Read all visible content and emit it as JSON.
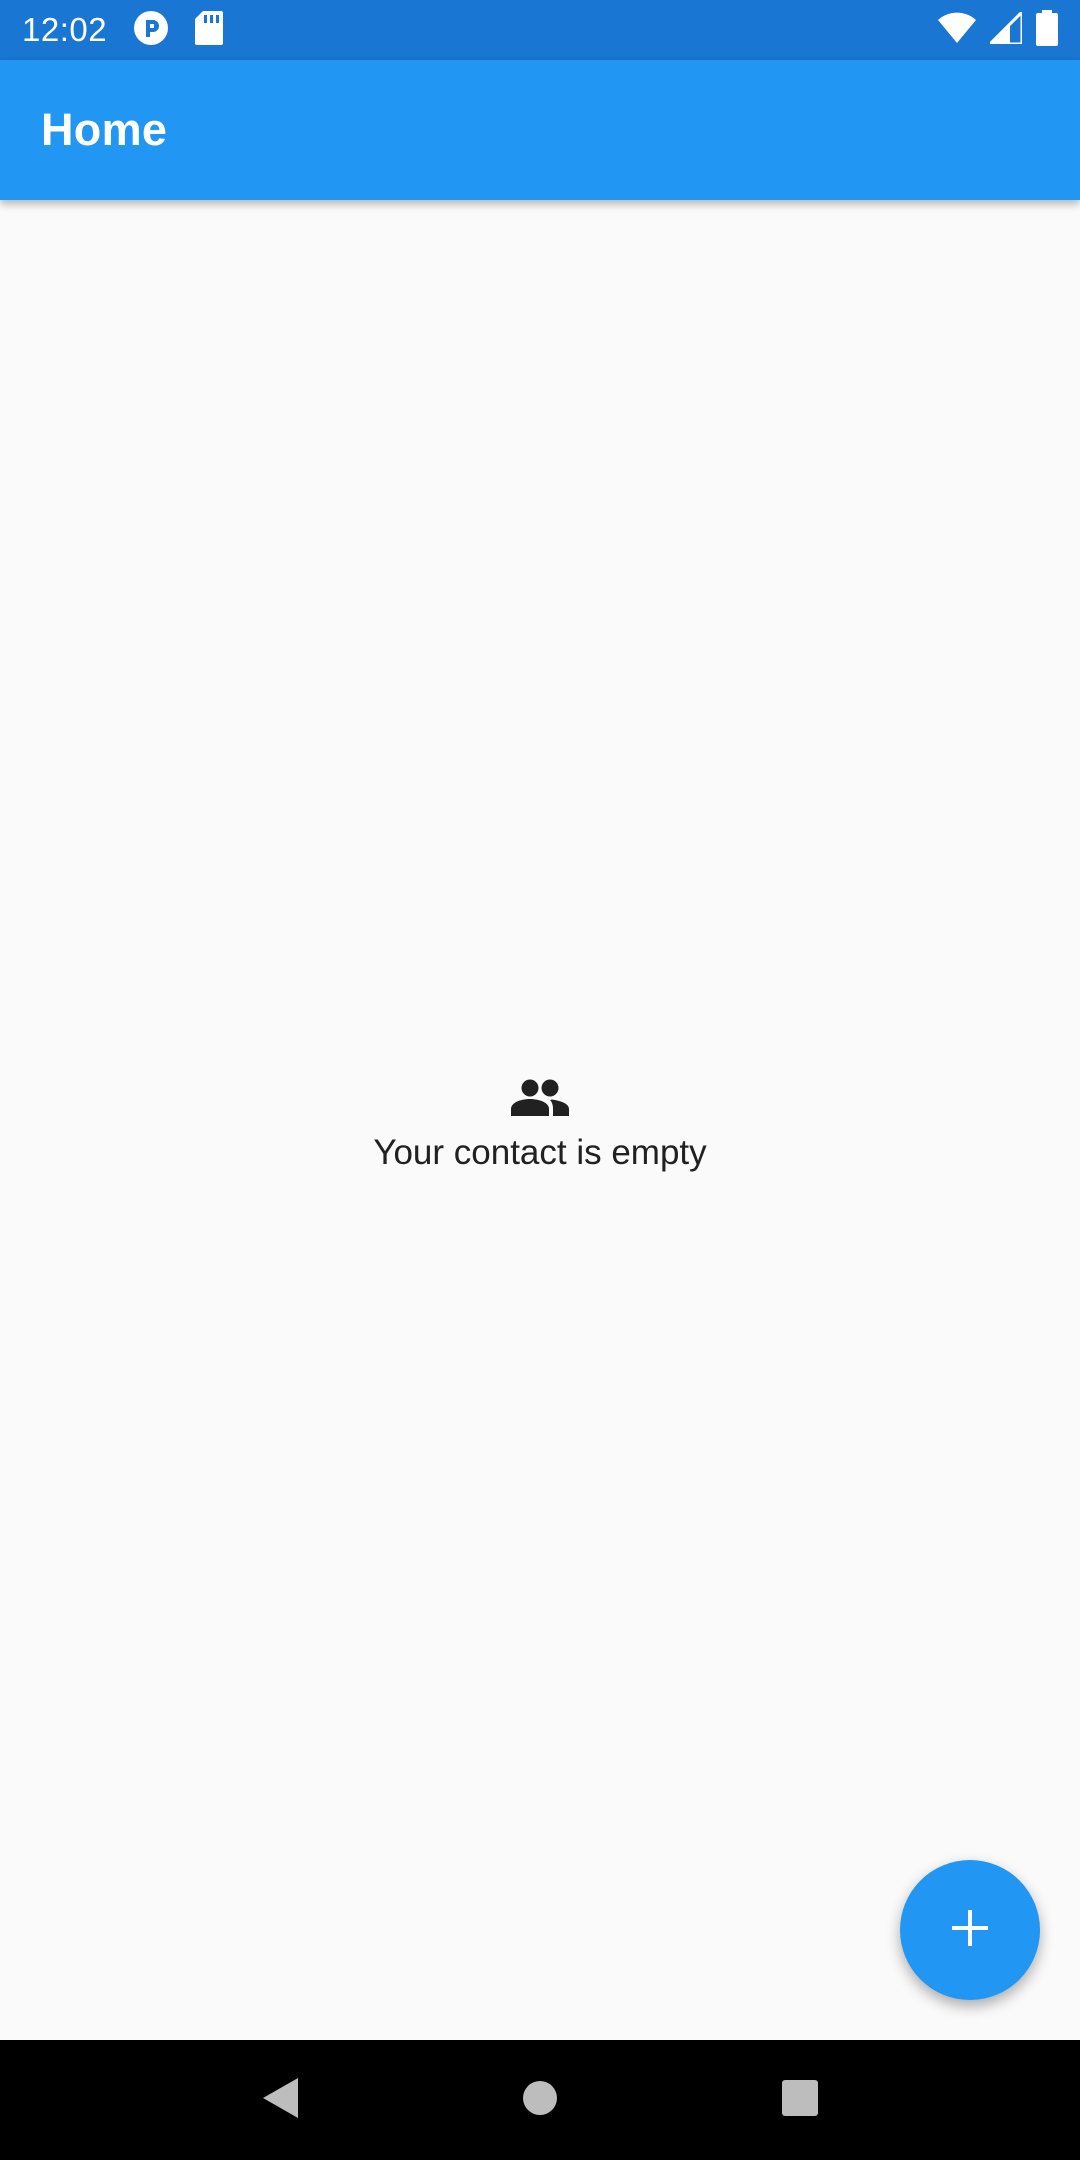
{
  "status_bar": {
    "time": "12:02",
    "icons": [
      "pocket-casts-icon",
      "sd-card-icon",
      "wifi-icon",
      "signal-icon",
      "battery-icon"
    ]
  },
  "app_bar": {
    "title": "Home"
  },
  "empty_state": {
    "icon": "people-icon",
    "message": "Your contact is empty"
  },
  "fab": {
    "icon": "add-icon"
  },
  "nav_bar": {
    "buttons": [
      "back-icon",
      "home-icon",
      "recents-icon"
    ]
  },
  "colors": {
    "status_bar": "#1976d2",
    "app_bar": "#2196f3",
    "fab": "#2196f3",
    "background": "#fafafa",
    "text": "#212121"
  }
}
